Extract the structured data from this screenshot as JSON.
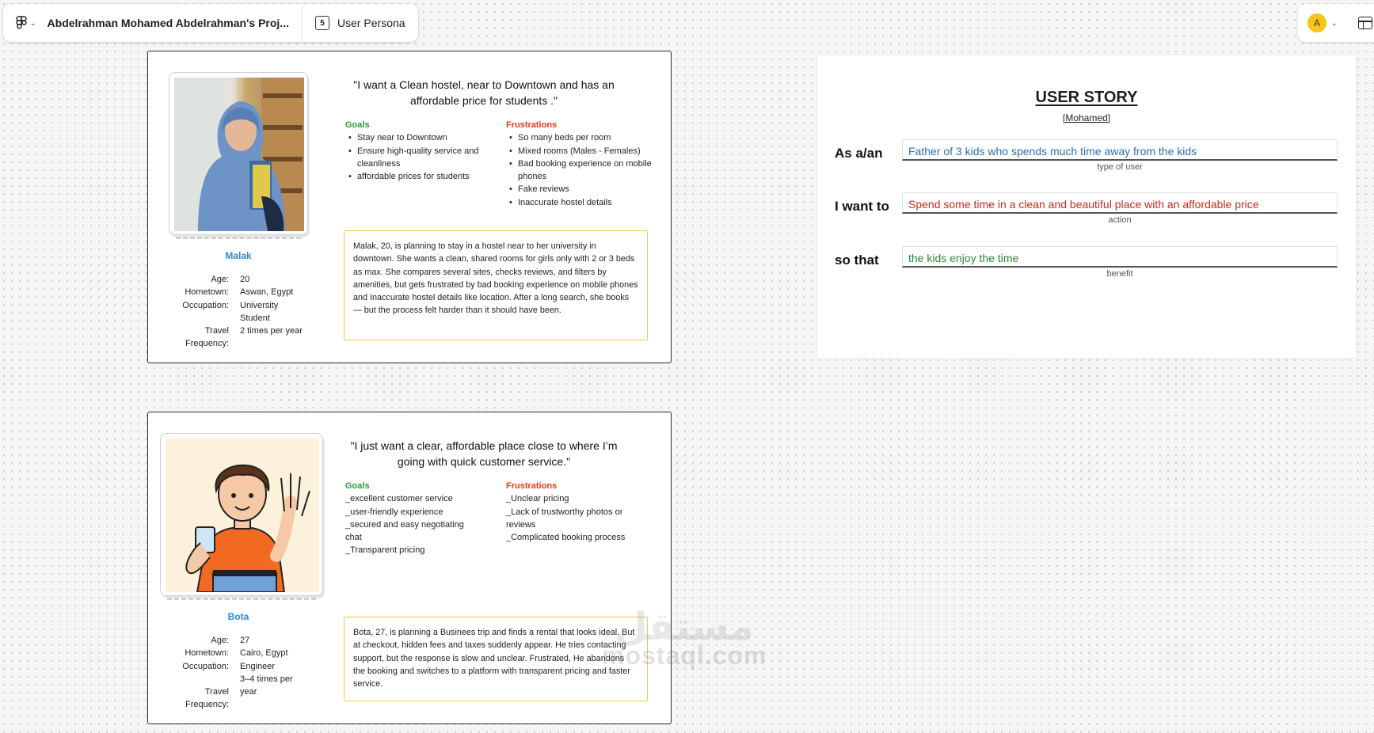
{
  "toolbar": {
    "project_name": "Abdelrahman Mohamed Abdelrahman's Proj...",
    "page_number": "5",
    "page_name": "User Persona",
    "avatar_letter": "A"
  },
  "personas": [
    {
      "quote": "\"I want a Clean hostel, near to Downtown and has an affordable price for students .\"",
      "goals_title": "Goals",
      "goals": [
        "Stay near to Downtown",
        "Ensure high-quality service and cleanliness",
        "affordable prices for students"
      ],
      "frustrations_title": "Frustrations",
      "frustrations": [
        "So many beds per room",
        "Mixed rooms (Males - Females)",
        "Bad booking experience on mobile phones",
        "Fake reviews",
        "Inaccurate hostel details"
      ],
      "name": "Malak",
      "details": [
        {
          "label": "Age:",
          "value": "20"
        },
        {
          "label": "Hometown:",
          "value": "Aswan, Egypt"
        },
        {
          "label": "Occupation:",
          "value": "University Student"
        },
        {
          "label": "Travel Frequency:",
          "value": "2 times per year"
        }
      ],
      "scenario": "Malak, 20, is planning to stay in a hostel near to her university in downtown. She wants a clean, shared rooms for girls only with 2 or 3 beds as max. She compares several sites, checks reviews, and filters by amenities, but gets frustrated by bad booking experience on mobile phones and Inaccurate hostel details like location. After a long search, she books — but the process felt harder than it should have been."
    },
    {
      "quote": "\"I just want a clear, affordable place close to where I’m going with quick customer service.\"",
      "goals_title": "Goals",
      "goals": [
        "_excellent customer service",
        "_user-friendly experience",
        "_secured and easy negotiating chat",
        "_Transparent pricing"
      ],
      "frustrations_title": "Frustrations",
      "frustrations": [
        "_Unclear pricing",
        "_Lack of trustworthy photos or reviews",
        "_Complicated booking process"
      ],
      "name": "Bota",
      "details": [
        {
          "label": "Age:",
          "value": "27"
        },
        {
          "label": "Hometown:",
          "value": "Cairo, Egypt"
        },
        {
          "label": "Occupation:",
          "value": "Engineer"
        },
        {
          "label": "",
          "value": "3–4 times per"
        },
        {
          "label": "Travel Frequency:",
          "value": "year"
        }
      ],
      "scenario": "Bota, 27, is planning a Businees trip and finds a rental that looks ideal. But at checkout, hidden fees and taxes suddenly appear. He tries contacting support, but the response is slow and unclear. Frustrated, He abandons the booking and switches to a platform with transparent pricing and faster service."
    }
  ],
  "user_story": {
    "title": "USER STORY",
    "author": "[Mohamed]",
    "rows": [
      {
        "label": "As a/an",
        "value": "Father of 3 kids who spends much time away from the kids",
        "hint": "type of user",
        "color": "#2a6fb8"
      },
      {
        "label": "I want to",
        "value": "Spend some time in a clean and beautiful place with an affordable price",
        "hint": "action",
        "color": "#c62b1d"
      },
      {
        "label": "so that",
        "value": "the kids enjoy the time",
        "hint": "benefit",
        "color": "#2b8a34"
      }
    ]
  },
  "watermark": {
    "latin": "mostaql.com",
    "arabic": "مستقل"
  },
  "icons": [
    "figma-logo-icon",
    "chevron-down-icon",
    "page-icon",
    "layout-icon"
  ]
}
